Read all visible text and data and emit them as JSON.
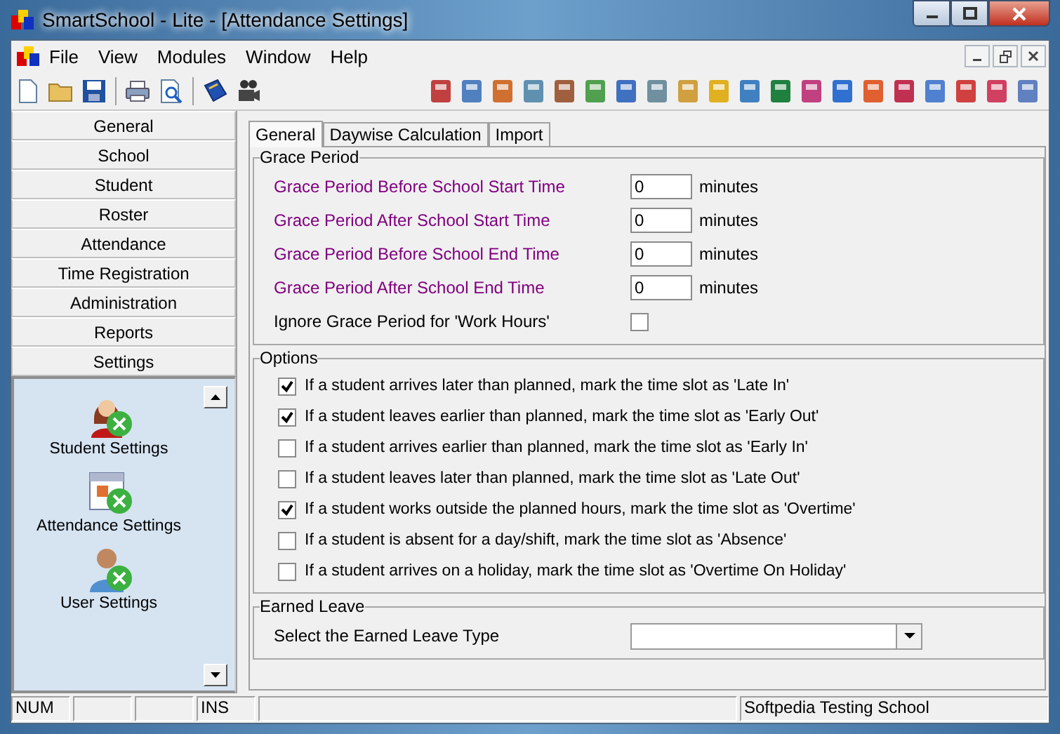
{
  "window": {
    "title": "SmartSchool - Lite - [Attendance Settings]"
  },
  "menu": [
    "File",
    "View",
    "Modules",
    "Window",
    "Help"
  ],
  "nav": [
    "General",
    "School",
    "Student",
    "Roster",
    "Attendance",
    "Time Registration",
    "Administration",
    "Reports",
    "Settings"
  ],
  "settings_panel": [
    {
      "kind": "student",
      "label": "Student Settings"
    },
    {
      "kind": "calendar",
      "label": "Attendance Settings"
    },
    {
      "kind": "user",
      "label": "User Settings"
    }
  ],
  "tabs": [
    {
      "label": "General",
      "selected": true
    },
    {
      "label": "Daywise Calculation",
      "selected": false
    },
    {
      "label": "Import",
      "selected": false
    }
  ],
  "grace_period": {
    "title": "Grace Period",
    "fields": [
      {
        "label": "Grace Period Before School Start Time",
        "value": "0",
        "unit": "minutes"
      },
      {
        "label": "Grace Period After School Start Time",
        "value": "0",
        "unit": "minutes"
      },
      {
        "label": "Grace Period Before School End Time",
        "value": "0",
        "unit": "minutes"
      },
      {
        "label": "Grace Period After School End Time",
        "value": "0",
        "unit": "minutes"
      }
    ],
    "ignore": {
      "label": "Ignore Grace Period for 'Work Hours'",
      "checked": false
    }
  },
  "options": {
    "title": "Options",
    "items": [
      {
        "label": "If a student arrives later than planned, mark the time slot as 'Late In'",
        "checked": true
      },
      {
        "label": "If a student leaves earlier than planned, mark the time slot as 'Early Out'",
        "checked": true
      },
      {
        "label": "If a student arrives earlier than planned, mark the time slot as 'Early In'",
        "checked": false
      },
      {
        "label": "If a student leaves later than planned, mark the time slot as 'Late Out'",
        "checked": false
      },
      {
        "label": "If a student works outside the planned hours, mark the time slot as 'Overtime'",
        "checked": true
      },
      {
        "label": "If a student is absent for a day/shift, mark the time slot as 'Absence'",
        "checked": false
      },
      {
        "label": "If a student arrives on a holiday, mark the time slot as 'Overtime On Holiday'",
        "checked": false
      }
    ]
  },
  "earned_leave": {
    "title": "Earned Leave",
    "label": "Select the Earned Leave Type"
  },
  "status_bar": {
    "num": "NUM",
    "ins": "INS",
    "school": "Softpedia Testing School"
  }
}
